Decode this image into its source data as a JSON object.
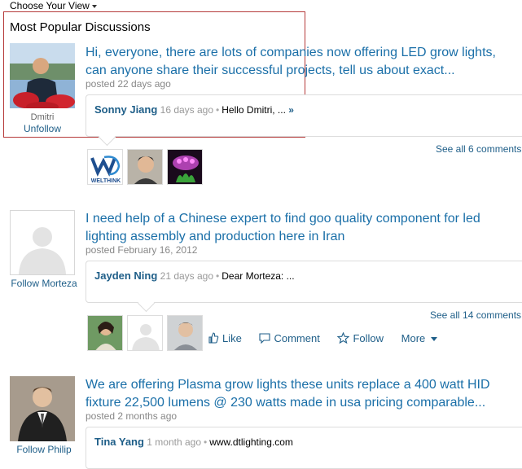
{
  "header": {
    "view_toggle": "Choose Your View",
    "section_title": "Most Popular Discussions"
  },
  "discussions": [
    {
      "author": "Dmitri",
      "follow": "Unfollow",
      "title": "Hi, everyone, there are lots of companies now offering LED grow lights, can anyone share their successful projects, tell us about exact...",
      "posted": "posted 22 days ago",
      "comment": {
        "name": "Sonny Jiang",
        "ago": "16 days ago",
        "text": "Hello Dmitri, ...",
        "more": "»"
      },
      "see_all": "See all 6 comments",
      "thumbs": [
        "welthink-logo",
        "commenter-photo",
        "grow-light-photo"
      ],
      "thumb_label": "WELTHINK"
    },
    {
      "author": "",
      "follow": "Follow Morteza",
      "title": "I need help of a Chinese expert to find goo quality component for led lighting assembly and production here in Iran",
      "posted": "posted February 16, 2012",
      "comment": {
        "name": "Jayden Ning",
        "ago": "21 days ago",
        "text": "Dear Morteza: ..."
      },
      "see_all": "See all 14 comments",
      "thumbs": [
        "woman-photo",
        "ghost-avatar",
        "man-photo"
      ]
    },
    {
      "author": "",
      "follow": "Follow Philip",
      "title": "We are offering Plasma grow lights these units replace a 400 watt HID fixture 22,500 lumens @ 230 watts made in usa pricing comparable...",
      "posted": "posted 2 months ago",
      "comment": {
        "name": "Tina Yang",
        "ago": "1 month ago",
        "text": "www.dtlighting.com"
      }
    }
  ],
  "actions": {
    "like": "Like",
    "comment": "Comment",
    "follow": "Follow",
    "more": "More"
  },
  "colors": {
    "link": "#1a6fa8",
    "highlight_border": "#b53a3a"
  }
}
